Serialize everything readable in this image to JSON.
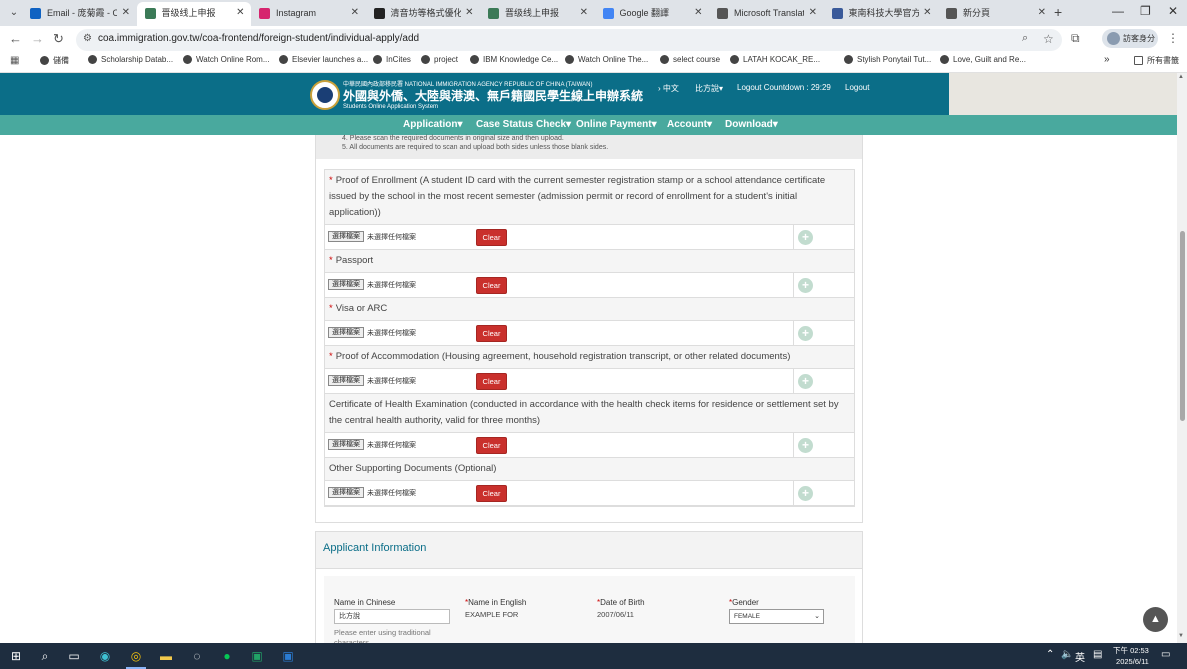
{
  "browser": {
    "tabs": [
      {
        "label": "Email - 庞菊霞 - Outl",
        "icon_color": "#0f62c2"
      },
      {
        "label": "晋级线上申报",
        "icon_color": "#3b7a57",
        "active": true
      },
      {
        "label": "Instagram",
        "icon_color": "#d6246e"
      },
      {
        "label": "清音坊等格式優化",
        "icon_color": "#222222"
      },
      {
        "label": "晋级线上申报",
        "icon_color": "#3b7a57"
      },
      {
        "label": "Google 翻譯",
        "icon_color": "#4285f4"
      },
      {
        "label": "Microsoft Translato",
        "icon_color": "#555555"
      },
      {
        "label": "東南科技大學官方網",
        "icon_color": "#3a5a9a"
      },
      {
        "label": "新分頁",
        "icon_color": "#555555"
      }
    ],
    "url": "coa.immigration.gov.tw/coa-frontend/foreign-student/individual-apply/add",
    "profile_label": "訪客身分",
    "bookmarks": [
      "儲備",
      "Scholarship Datab...",
      "Watch Online Rom...",
      "Elsevier launches a...",
      "InCites",
      "project",
      "IBM Knowledge Ce...",
      "Watch Online The...",
      "select course",
      "LATAH KOCAK_RE...",
      "Stylish Ponytail Tut...",
      "Love, Guilt and Re..."
    ],
    "bookmarks_all": "所有書籤"
  },
  "site": {
    "agency_name": "中華民國內政部移民署 NATIONAL IMMIGRATION AGENCY REPUBLIC OF CHINA (TAIWAN)",
    "system_title": "外國與外僑、大陸與港澳、無戶籍國民學生線上申辦系統",
    "system_subtitle": "Students Online Application System",
    "header_links": {
      "lang": "中文",
      "user": "比方說",
      "countdown": "Logout Countdown : 29:29",
      "logout": "Logout"
    },
    "nav": [
      "Application",
      "Case Status Check",
      "Online Payment",
      "Account",
      "Download"
    ]
  },
  "upload": {
    "notes": [
      "4. Please scan the required documents in original size and then upload.",
      "5. All documents are required to scan and upload both sides unless those blank sides."
    ],
    "file_button_label": "選擇檔案",
    "file_status": "未選擇任何檔案",
    "clear_label": "Clear",
    "plus_symbol": "+",
    "documents": [
      {
        "required": true,
        "label": "Proof of Enrollment (A student ID card with the current semester registration stamp or a school attendance certificate issued by the school in the most recent semester (admission permit or record of enrollment for a student's initial application))"
      },
      {
        "required": true,
        "label": "Passport"
      },
      {
        "required": true,
        "label": "Visa or ARC"
      },
      {
        "required": true,
        "label": "Proof of Accommodation (Housing agreement, household registration transcript, or other related documents)"
      },
      {
        "required": false,
        "label": "Certificate of Health Examination (conducted in accordance with the health check items for residence or settlement set by the central health authority, valid for three months)"
      },
      {
        "required": false,
        "label": "Other Supporting Documents (Optional)"
      }
    ]
  },
  "applicant": {
    "title": "Applicant Information",
    "name_chinese_label": "Name in Chinese",
    "name_chinese_value": "比方說",
    "name_chinese_hint": "Please enter using traditional characters",
    "name_english_label": "Name in English",
    "name_english_value": "EXAMPLE FOR",
    "dob_label": "Date of Birth",
    "dob_value": "2007/06/11",
    "gender_label": "Gender",
    "gender_value": "FEMALE"
  },
  "taskbar": {
    "lang": "英",
    "time": "下午 02:53",
    "date": "2025/6/11"
  }
}
